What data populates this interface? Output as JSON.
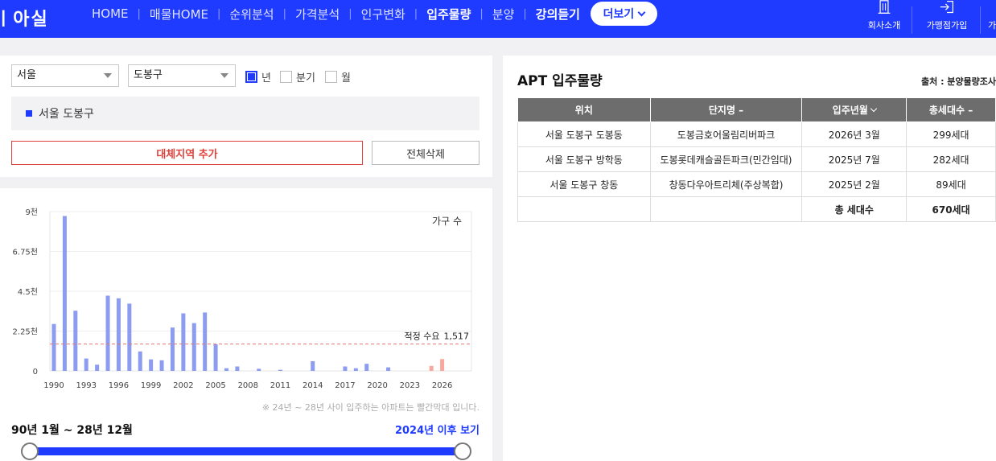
{
  "header": {
    "logo": "ㅣ아실",
    "nav": [
      {
        "label": "HOME",
        "style": "normal"
      },
      {
        "label": "매물HOME",
        "style": "normal"
      },
      {
        "label": "순위분석",
        "style": "normal"
      },
      {
        "label": "가격분석",
        "style": "normal"
      },
      {
        "label": "인구변화",
        "style": "normal"
      },
      {
        "label": "입주물량",
        "style": "active"
      },
      {
        "label": "분양",
        "style": "normal"
      },
      {
        "label": "강의듣기",
        "style": "bold"
      }
    ],
    "separator": "|",
    "more_label": "더보기",
    "util": [
      {
        "label": "회사소개",
        "icon": "building-icon"
      },
      {
        "label": "가맹점가입",
        "icon": "sign-in-icon"
      },
      {
        "label": "가",
        "icon": "partial-icon"
      }
    ]
  },
  "filters": {
    "city": "서울",
    "district": "도봉구",
    "period_options": [
      {
        "label": "년",
        "checked": true
      },
      {
        "label": "분기",
        "checked": false
      },
      {
        "label": "월",
        "checked": false
      }
    ]
  },
  "region_label": "서울 도봉구",
  "buttons": {
    "add": "대체지역 추가",
    "clear": "전체삭제"
  },
  "chart_note": "※ 24년 ~ 28년 사이 입주하는 아파트는 빨간막대 입니다.",
  "range": {
    "label": "90년 1월 ~ 28년 12월",
    "link": "2024년 이후 보기"
  },
  "chart_data": {
    "type": "bar",
    "legend": "가구 수",
    "y_ticks": [
      "0",
      "2.25천",
      "4.5천",
      "6.75천",
      "9천"
    ],
    "ylim": [
      0,
      9000
    ],
    "x_tick_labels": [
      "1990",
      "1993",
      "1996",
      "1999",
      "2002",
      "2005",
      "2008",
      "2011",
      "2014",
      "2017",
      "2020",
      "2023",
      "2026"
    ],
    "x": [
      1990,
      1991,
      1992,
      1993,
      1994,
      1995,
      1996,
      1997,
      1998,
      1999,
      2000,
      2001,
      2002,
      2003,
      2004,
      2005,
      2006,
      2007,
      2008,
      2009,
      2010,
      2011,
      2012,
      2013,
      2014,
      2015,
      2016,
      2017,
      2018,
      2019,
      2020,
      2021,
      2022,
      2023,
      2024,
      2025,
      2026,
      2027,
      2028
    ],
    "values": [
      2650,
      8750,
      3400,
      700,
      350,
      4250,
      4100,
      3800,
      1100,
      650,
      600,
      2450,
      3250,
      2700,
      3300,
      1500,
      150,
      250,
      0,
      120,
      0,
      60,
      0,
      0,
      550,
      0,
      0,
      250,
      150,
      400,
      0,
      200,
      0,
      0,
      0,
      282,
      670,
      0,
      0
    ],
    "highlight_range": [
      2024,
      2028
    ],
    "bar_color": "#8c9cf0",
    "highlight_color": "#f7a9a0",
    "reference_line": {
      "label": "적정 수요",
      "value": 1517,
      "value_text": "1,517",
      "color": "#e4736e"
    }
  },
  "apt": {
    "title": "APT 입주물량",
    "source": "출처 : 분양물량조사",
    "columns": [
      "위치",
      "단지명 –",
      "입주년월",
      "총세대수 –"
    ],
    "rows": [
      [
        "서울 도봉구 도봉동",
        "도봉금호어울림리버파크",
        "2026년 3월",
        "299세대"
      ],
      [
        "서울 도봉구 방학동",
        "도봉롯데캐슬골든파크(민간임대)",
        "2025년 7월",
        "282세대"
      ],
      [
        "서울 도봉구 창동",
        "창동다우아트리체(주상복합)",
        "2025년 2월",
        "89세대"
      ]
    ],
    "total_label": "총 세대수",
    "total_value": "670세대"
  }
}
